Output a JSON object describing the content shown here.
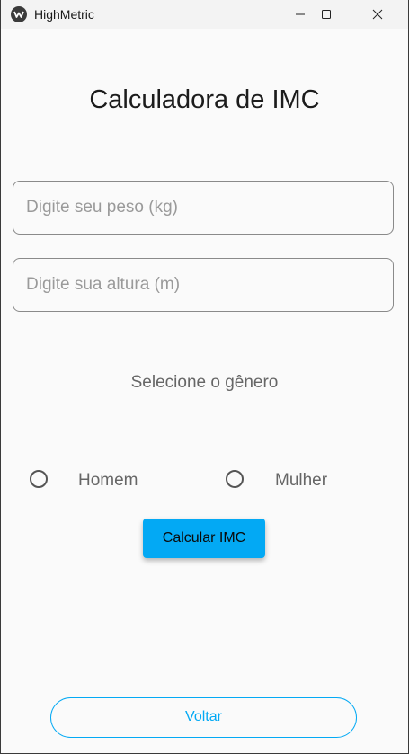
{
  "window": {
    "title": "HighMetric",
    "icons": {
      "app": "app-logo-icon",
      "minimize": "minimize-icon",
      "maximize": "maximize-icon",
      "close": "close-icon"
    }
  },
  "main": {
    "heading": "Calculadora de IMC",
    "weight_placeholder": "Digite seu peso (kg)",
    "height_placeholder": "Digite sua altura (m)",
    "weight_value": "",
    "height_value": "",
    "gender_prompt": "Selecione o gênero",
    "gender_options": [
      {
        "label": "Homem",
        "selected": false
      },
      {
        "label": "Mulher",
        "selected": false
      }
    ],
    "calculate_label": "Calcular IMC",
    "back_label": "Voltar"
  },
  "colors": {
    "accent": "#03a9f4",
    "background": "#fafafa",
    "titlebar": "#f3f3f3"
  }
}
